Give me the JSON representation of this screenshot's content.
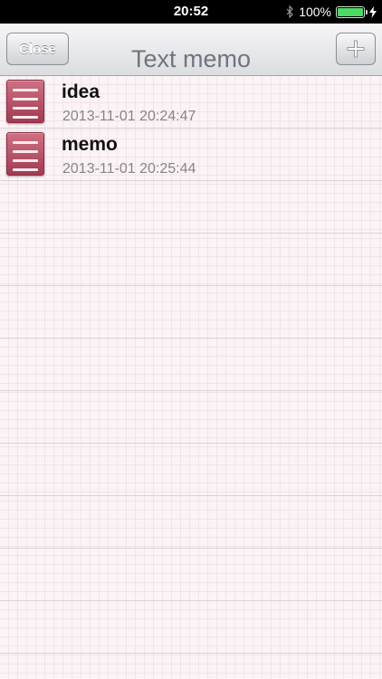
{
  "status_bar": {
    "time": "20:52",
    "battery": "100%",
    "battery_color": "#4cd964"
  },
  "nav": {
    "title": "Text memo",
    "close_label": "Close",
    "add_icon": "plus-icon"
  },
  "memos": [
    {
      "title": "idea",
      "date": "2013-11-01 20:24:47",
      "icon": "memo-note-icon"
    },
    {
      "title": "memo",
      "date": "2013-11-01 20:25:44",
      "icon": "memo-note-icon"
    }
  ],
  "colors": {
    "memo_icon": "#b24a62",
    "paper": "#fbf3f5"
  }
}
